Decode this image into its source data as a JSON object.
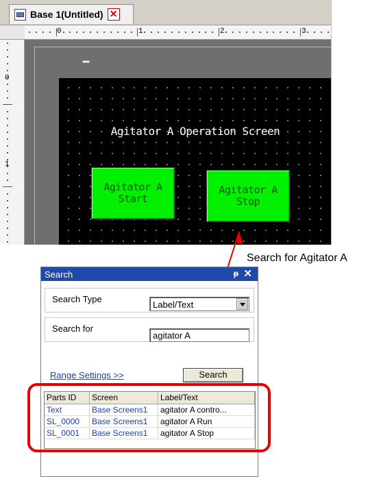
{
  "editor": {
    "tab_title": "Base 1(Untitled)",
    "tab_close_glyph": "✕",
    "ruler": {
      "h_labels": [
        "0",
        "1",
        "2",
        "3"
      ],
      "v_labels": [
        "0",
        "1"
      ]
    },
    "screen": {
      "title": "Agitator A Operation Screen",
      "buttons": [
        {
          "line1": "Agitator A",
          "line2": "Start",
          "color": "#00f000"
        },
        {
          "line1": "Agitator A",
          "line2": "Stop",
          "color": "#00f000"
        }
      ]
    }
  },
  "annotation": {
    "text": "Search for Agitator A",
    "color": "#e60000"
  },
  "search": {
    "title": "Search",
    "pin_glyph": "ᵽ",
    "close_glyph": "✕",
    "type_label": "Search Type",
    "type_value": "Label/Text",
    "for_label": "Search for",
    "for_value": "agitator A",
    "range_link": "Range Settings >>",
    "button": "Search",
    "columns": [
      "Parts ID",
      "Screen",
      "Label/Text"
    ],
    "rows": [
      {
        "id": "Text",
        "screen": "Base Screens1",
        "label": "agitator A contro..."
      },
      {
        "id": "SL_0000",
        "screen": "Base Screens1",
        "label": "agitator A Run"
      },
      {
        "id": "SL_0001",
        "screen": "Base Screens1",
        "label": "agitator A Stop"
      }
    ]
  }
}
